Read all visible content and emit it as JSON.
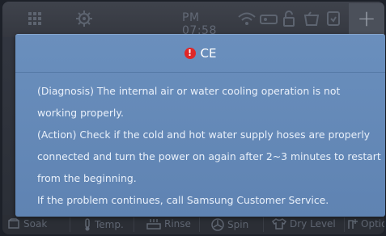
{
  "status": {
    "time": "PM 07:58",
    "icons": [
      "grid-icon",
      "gear-icon",
      "wifi-icon",
      "remote-icon",
      "lock-icon",
      "basket-icon",
      "notification-icon"
    ],
    "add_label": "+"
  },
  "dialog": {
    "code": "CE",
    "lines": [
      "(Diagnosis) The internal air or water cooling operation is not",
      "working properly.",
      "(Action) Check if the cold and hot water supply hoses are properly",
      "connected and turn the power on again after 2~3 minutes to restart",
      "from the beginning.",
      "If the problem continues, call Samsung Customer Service."
    ]
  },
  "options": [
    {
      "label": "Soak",
      "icon": "soak-icon"
    },
    {
      "label": "Temp.",
      "icon": "thermometer-icon"
    },
    {
      "label": "Rinse",
      "icon": "rinse-icon"
    },
    {
      "label": "Spin",
      "icon": "spin-icon"
    },
    {
      "label": "Dry Level",
      "icon": "shirt-icon"
    },
    {
      "label": "Options",
      "icon": "options-icon"
    }
  ],
  "colors": {
    "dialog_bg": "#6589b8",
    "alert": "#e02727",
    "screen_bg": "#2e3139"
  }
}
